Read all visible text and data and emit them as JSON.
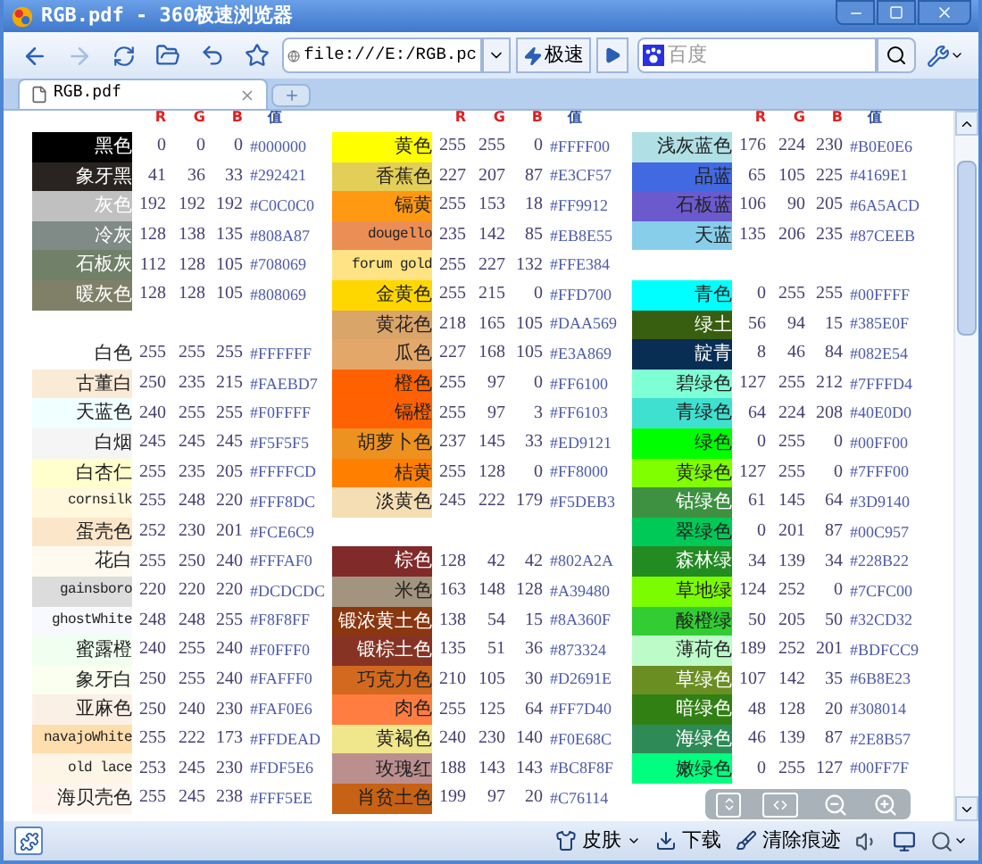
{
  "window": {
    "title": "RGB.pdf - 360极速浏览器"
  },
  "toolbar": {
    "address": "file:///E:/RGB.pc",
    "speed_button": "极速",
    "search": {
      "placeholder": "百度"
    }
  },
  "tabs": [
    {
      "label": "RGB.pdf",
      "selected": true
    }
  ],
  "page": {
    "groups": [
      {
        "headers": [
          "R",
          "G",
          "B",
          "值"
        ],
        "sections": [
          [
            {
              "name": "黑色",
              "r": "0",
              "g": "0",
              "b": "0",
              "hex": "#000000",
              "color": "#000000",
              "light_text": true
            },
            {
              "name": "象牙黑",
              "r": "41",
              "g": "36",
              "b": "33",
              "hex": "#292421",
              "color": "#292421",
              "light_text": true
            },
            {
              "name": "灰色",
              "r": "192",
              "g": "192",
              "b": "192",
              "hex": "#C0C0C0",
              "color": "#c0c0c0",
              "light_text": true
            },
            {
              "name": "冷灰",
              "r": "128",
              "g": "138",
              "b": "135",
              "hex": "#808A87",
              "color": "#808a87",
              "light_text": true
            },
            {
              "name": "石板灰",
              "r": "112",
              "g": "128",
              "b": "105",
              "hex": "#708069",
              "color": "#708069",
              "light_text": true
            },
            {
              "name": "暖灰色",
              "r": "128",
              "g": "128",
              "b": "105",
              "hex": "#808069",
              "color": "#808069",
              "light_text": true
            }
          ],
          [
            {
              "name": "白色",
              "r": "255",
              "g": "255",
              "b": "255",
              "hex": "#FFFFFF",
              "color": "#ffffff",
              "light_text": false
            },
            {
              "name": "古董白",
              "r": "250",
              "g": "235",
              "b": "215",
              "hex": "#FAEBD7",
              "color": "#faebd7",
              "light_text": false
            },
            {
              "name": "天蓝色",
              "r": "240",
              "g": "255",
              "b": "255",
              "hex": "#F0FFFF",
              "color": "#f0ffff",
              "light_text": false
            },
            {
              "name": "白烟",
              "r": "245",
              "g": "245",
              "b": "245",
              "hex": "#F5F5F5",
              "color": "#f5f5f5",
              "light_text": false
            },
            {
              "name": "白杏仁",
              "r": "255",
              "g": "235",
              "b": "205",
              "hex": "#FFFFCD",
              "color": "#ffffcd",
              "light_text": false
            },
            {
              "name": "cornsilk",
              "r": "255",
              "g": "248",
              "b": "220",
              "hex": "#FFF8DC",
              "color": "#fff8dc",
              "light_text": false
            },
            {
              "name": "蛋壳色",
              "r": "252",
              "g": "230",
              "b": "201",
              "hex": "#FCE6C9",
              "color": "#fce6c9",
              "light_text": false
            },
            {
              "name": "花白",
              "r": "255",
              "g": "250",
              "b": "240",
              "hex": "#FFFAF0",
              "color": "#fffaf0",
              "light_text": false
            },
            {
              "name": "gainsboro",
              "r": "220",
              "g": "220",
              "b": "220",
              "hex": "#DCDCDC",
              "color": "#dcdcdc",
              "light_text": false
            },
            {
              "name": "ghostWhite",
              "r": "248",
              "g": "248",
              "b": "255",
              "hex": "#F8F8FF",
              "color": "#f8f8ff",
              "light_text": false
            },
            {
              "name": "蜜露橙",
              "r": "240",
              "g": "255",
              "b": "240",
              "hex": "#F0FFF0",
              "color": "#f0fff0",
              "light_text": false
            },
            {
              "name": "象牙白",
              "r": "250",
              "g": "255",
              "b": "240",
              "hex": "#FAFFF0",
              "color": "#fafff0",
              "light_text": false
            },
            {
              "name": "亚麻色",
              "r": "250",
              "g": "240",
              "b": "230",
              "hex": "#FAF0E6",
              "color": "#faf0e6",
              "light_text": false
            },
            {
              "name": "navajoWhite",
              "r": "255",
              "g": "222",
              "b": "173",
              "hex": "#FFDEAD",
              "color": "#ffdead",
              "light_text": false
            },
            {
              "name": "old lace",
              "r": "253",
              "g": "245",
              "b": "230",
              "hex": "#FDF5E6",
              "color": "#fdf5e6",
              "light_text": false
            },
            {
              "name": "海贝壳色",
              "r": "255",
              "g": "245",
              "b": "238",
              "hex": "#FFF5EE",
              "color": "#fff5ee",
              "light_text": false
            }
          ]
        ]
      },
      {
        "headers": [
          "R",
          "G",
          "B",
          "值"
        ],
        "sections": [
          [
            {
              "name": "黄色",
              "r": "255",
              "g": "255",
              "b": "0",
              "hex": "#FFFF00",
              "color": "#ffff00",
              "light_text": false
            },
            {
              "name": "香蕉色",
              "r": "227",
              "g": "207",
              "b": "87",
              "hex": "#E3CF57",
              "color": "#e3cf57",
              "light_text": false
            },
            {
              "name": "镉黄",
              "r": "255",
              "g": "153",
              "b": "18",
              "hex": "#FF9912",
              "color": "#ff9912",
              "light_text": false
            },
            {
              "name": "dougello",
              "r": "235",
              "g": "142",
              "b": "85",
              "hex": "#EB8E55",
              "color": "#eb8e55",
              "light_text": false
            },
            {
              "name": "forum gold",
              "r": "255",
              "g": "227",
              "b": "132",
              "hex": "#FFE384",
              "color": "#ffe384",
              "light_text": false
            },
            {
              "name": "金黄色",
              "r": "255",
              "g": "215",
              "b": "0",
              "hex": "#FFD700",
              "color": "#ffd700",
              "light_text": false
            },
            {
              "name": "黄花色",
              "r": "218",
              "g": "165",
              "b": "105",
              "hex": "#DAA569",
              "color": "#daa569",
              "light_text": false
            },
            {
              "name": "瓜色",
              "r": "227",
              "g": "168",
              "b": "105",
              "hex": "#E3A869",
              "color": "#e3a869",
              "light_text": false
            },
            {
              "name": "橙色",
              "r": "255",
              "g": "97",
              "b": "0",
              "hex": "#FF6100",
              "color": "#ff6100",
              "light_text": false
            },
            {
              "name": "镉橙",
              "r": "255",
              "g": "97",
              "b": "3",
              "hex": "#FF6103",
              "color": "#ff6103",
              "light_text": false
            },
            {
              "name": "胡萝卜色",
              "r": "237",
              "g": "145",
              "b": "33",
              "hex": "#ED9121",
              "color": "#ed9121",
              "light_text": false
            },
            {
              "name": "桔黄",
              "r": "255",
              "g": "128",
              "b": "0",
              "hex": "#FF8000",
              "color": "#ff8000",
              "light_text": false
            },
            {
              "name": "淡黄色",
              "r": "245",
              "g": "222",
              "b": "179",
              "hex": "#F5DEB3",
              "color": "#f5deb3",
              "light_text": false
            }
          ],
          [
            {
              "name": "棕色",
              "r": "128",
              "g": "42",
              "b": "42",
              "hex": "#802A2A",
              "color": "#802a2a",
              "light_text": true
            },
            {
              "name": "米色",
              "r": "163",
              "g": "148",
              "b": "128",
              "hex": "#A39480",
              "color": "#a39480",
              "light_text": false
            },
            {
              "name": "锻浓黄土色",
              "r": "138",
              "g": "54",
              "b": "15",
              "hex": "#8A360F",
              "color": "#8a360f",
              "light_text": true
            },
            {
              "name": "锻棕土色",
              "r": "135",
              "g": "51",
              "b": "36",
              "hex": "#873324",
              "color": "#873324",
              "light_text": true
            },
            {
              "name": "巧克力色",
              "r": "210",
              "g": "105",
              "b": "30",
              "hex": "#D2691E",
              "color": "#d2691e",
              "light_text": false
            },
            {
              "name": "肉色",
              "r": "255",
              "g": "125",
              "b": "64",
              "hex": "#FF7D40",
              "color": "#ff7d40",
              "light_text": false
            },
            {
              "name": "黄褐色",
              "r": "240",
              "g": "230",
              "b": "140",
              "hex": "#F0E68C",
              "color": "#f0e68c",
              "light_text": false
            },
            {
              "name": "玫瑰红",
              "r": "188",
              "g": "143",
              "b": "143",
              "hex": "#BC8F8F",
              "color": "#bc8f8f",
              "light_text": false
            },
            {
              "name": "肖贫土色",
              "r": "199",
              "g": "97",
              "b": "20",
              "hex": "#C76114",
              "color": "#c76114",
              "light_text": false
            }
          ]
        ]
      },
      {
        "headers": [
          "R",
          "G",
          "B",
          "值"
        ],
        "sections": [
          [
            {
              "name": "浅灰蓝色",
              "r": "176",
              "g": "224",
              "b": "230",
              "hex": "#B0E0E6",
              "color": "#b0e0e6",
              "light_text": false
            },
            {
              "name": "品蓝",
              "r": "65",
              "g": "105",
              "b": "225",
              "hex": "#4169E1",
              "color": "#4169e1",
              "light_text": false
            },
            {
              "name": "石板蓝",
              "r": "106",
              "g": "90",
              "b": "205",
              "hex": "#6A5ACD",
              "color": "#6a5acd",
              "light_text": false
            },
            {
              "name": "天蓝",
              "r": "135",
              "g": "206",
              "b": "235",
              "hex": "#87CEEB",
              "color": "#87ceeb",
              "light_text": false
            }
          ],
          [
            {
              "name": "青色",
              "r": "0",
              "g": "255",
              "b": "255",
              "hex": "#00FFFF",
              "color": "#00ffff",
              "light_text": false
            },
            {
              "name": "绿土",
              "r": "56",
              "g": "94",
              "b": "15",
              "hex": "#385E0F",
              "color": "#385e0f",
              "light_text": true
            },
            {
              "name": "靛青",
              "r": "8",
              "g": "46",
              "b": "84",
              "hex": "#082E54",
              "color": "#082e54",
              "light_text": true
            },
            {
              "name": "碧绿色",
              "r": "127",
              "g": "255",
              "b": "212",
              "hex": "#7FFFD4",
              "color": "#7fffd4",
              "light_text": false
            },
            {
              "name": "青绿色",
              "r": "64",
              "g": "224",
              "b": "208",
              "hex": "#40E0D0",
              "color": "#40e0d0",
              "light_text": false
            },
            {
              "name": "绿色",
              "r": "0",
              "g": "255",
              "b": "0",
              "hex": "#00FF00",
              "color": "#00ff00",
              "light_text": false
            },
            {
              "name": "黄绿色",
              "r": "127",
              "g": "255",
              "b": "0",
              "hex": "#7FFF00",
              "color": "#7fff00",
              "light_text": false
            },
            {
              "name": "钴绿色",
              "r": "61",
              "g": "145",
              "b": "64",
              "hex": "#3D9140",
              "color": "#3d9140",
              "light_text": true
            },
            {
              "name": "翠绿色",
              "r": "0",
              "g": "201",
              "b": "87",
              "hex": "#00C957",
              "color": "#00c957",
              "light_text": false
            },
            {
              "name": "森林绿",
              "r": "34",
              "g": "139",
              "b": "34",
              "hex": "#228B22",
              "color": "#228b22",
              "light_text": true
            },
            {
              "name": "草地绿",
              "r": "124",
              "g": "252",
              "b": "0",
              "hex": "#7CFC00",
              "color": "#7cfc00",
              "light_text": false
            },
            {
              "name": "酸橙绿",
              "r": "50",
              "g": "205",
              "b": "50",
              "hex": "#32CD32",
              "color": "#32cd32",
              "light_text": false
            },
            {
              "name": "薄荷色",
              "r": "189",
              "g": "252",
              "b": "201",
              "hex": "#BDFCC9",
              "color": "#bdfcc9",
              "light_text": false
            },
            {
              "name": "草绿色",
              "r": "107",
              "g": "142",
              "b": "35",
              "hex": "#6B8E23",
              "color": "#6b8e23",
              "light_text": true
            },
            {
              "name": "暗绿色",
              "r": "48",
              "g": "128",
              "b": "20",
              "hex": "#308014",
              "color": "#308014",
              "light_text": true
            },
            {
              "name": "海绿色",
              "r": "46",
              "g": "139",
              "b": "87",
              "hex": "#2E8B57",
              "color": "#2e8b57",
              "light_text": true
            },
            {
              "name": "嫩绿色",
              "r": "0",
              "g": "255",
              "b": "127",
              "hex": "#00FF7F",
              "color": "#00ff7f",
              "light_text": false
            }
          ]
        ]
      }
    ]
  },
  "status_bar": {
    "items": [
      "皮肤",
      "下载",
      "清除痕迹"
    ]
  }
}
